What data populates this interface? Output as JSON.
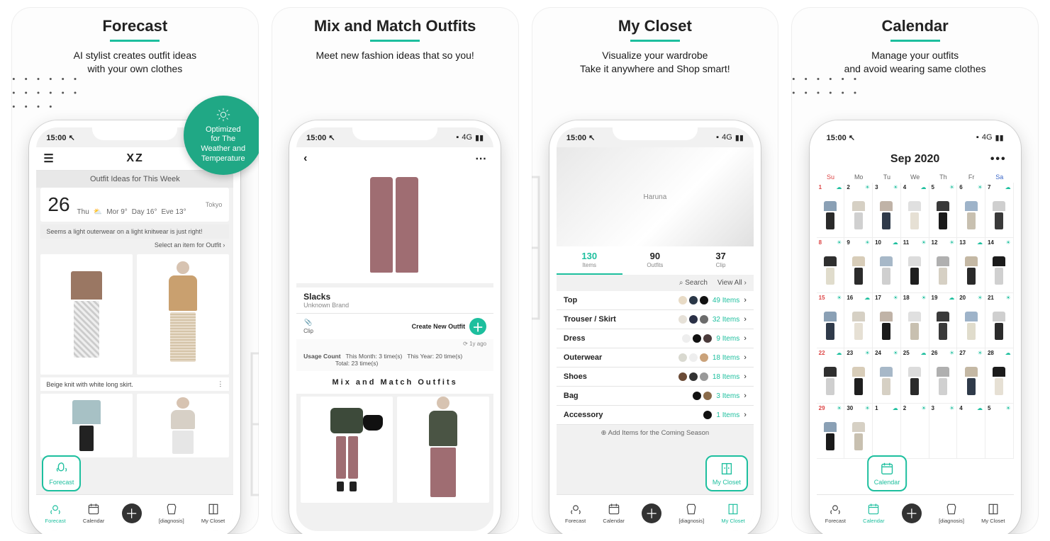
{
  "slots": [
    {
      "title": "Forecast",
      "subtitle1": "AI stylist creates outfit ideas",
      "subtitle2": "with your own clothes",
      "badge1": "Optimized",
      "badge2": "for The",
      "badge3": "Weather and",
      "badge4": "Temperature",
      "time": "15:00",
      "app_title": "XZ",
      "week_label": "Outfit Ideas for This Week",
      "date_num": "26",
      "date_dow": "Thu",
      "city": "Tokyo",
      "temps": {
        "mor": "Mor 9°",
        "day": "Day 16°",
        "eve": "Eve 13°"
      },
      "tip": "Seems a light outerwear on a light knitwear is just right!",
      "select_line": "Select an item for Outfit  ›",
      "caption": "Beige knit with white long skirt.",
      "float_label": "Forecast"
    },
    {
      "title": "Mix and Match Outfits",
      "subtitle1": "Meet new fashion ideas that so you!",
      "time": "15:00",
      "net": "4G",
      "item_name": "Slacks",
      "item_brand": "Unknown Brand",
      "clip": "Clip",
      "cta": "Create New Outfit",
      "ago": "1y ago",
      "usage_label": "Usage Count",
      "usage_month": "This Month: 3 time(s)",
      "usage_year": "This Year: 20 time(s)",
      "usage_total": "Total: 23 time(s)",
      "section": "Mix and Match Outfits"
    },
    {
      "title": "My Closet",
      "subtitle1": "Visualize your wardrobe",
      "subtitle2": "Take it anywhere and Shop smart!",
      "time": "15:00",
      "net": "4G",
      "cover_user": "Haruna",
      "segments": [
        {
          "n": "130",
          "l": "Items"
        },
        {
          "n": "90",
          "l": "Outfits"
        },
        {
          "n": "37",
          "l": "Clip"
        }
      ],
      "search": "Search",
      "viewall": "View All ›",
      "cats": [
        {
          "name": "Top",
          "count": "49 Items"
        },
        {
          "name": "Trouser / Skirt",
          "count": "32 Items"
        },
        {
          "name": "Dress",
          "count": "9 Items"
        },
        {
          "name": "Outerwear",
          "count": "18 Items"
        },
        {
          "name": "Shoes",
          "count": "18 Items"
        },
        {
          "name": "Bag",
          "count": "3 Items"
        },
        {
          "name": "Accessory",
          "count": "1 Items"
        }
      ],
      "add_season": "⊕ Add Items for the Coming Season",
      "float_label": "My Closet"
    },
    {
      "title": "Calendar",
      "subtitle1": "Manage your outfits",
      "subtitle2": "and avoid wearing same clothes",
      "time": "15:00",
      "net": "4G",
      "month": "Sep 2020",
      "weekdays": [
        "Su",
        "Mo",
        "Tu",
        "We",
        "Th",
        "Fr",
        "Sa"
      ],
      "days": [
        1,
        2,
        3,
        4,
        5,
        6,
        7,
        8,
        9,
        10,
        11,
        12,
        13,
        14,
        15,
        16,
        17,
        18,
        19,
        20,
        21,
        22,
        23,
        24,
        25,
        26,
        27,
        28,
        29,
        30,
        1,
        2,
        3,
        4,
        5
      ],
      "float_label": "Calendar"
    }
  ],
  "tabbar": {
    "forecast": "Forecast",
    "calendar": "Calendar",
    "diagnosis": "[diagnosis]",
    "closet": "My Closet"
  }
}
